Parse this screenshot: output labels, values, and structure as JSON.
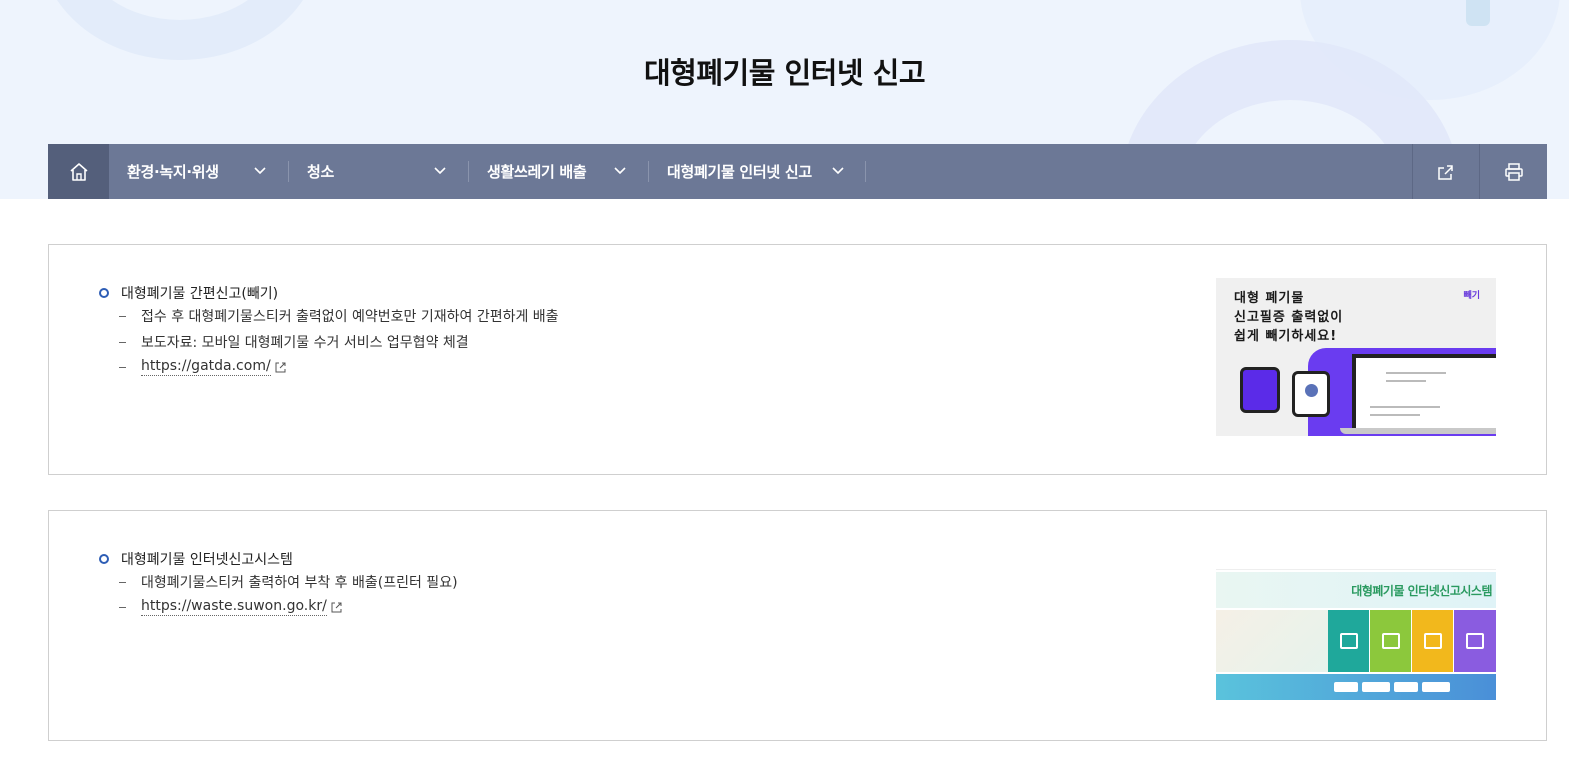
{
  "page_title": "대형폐기물 인터넷 신고",
  "nav": {
    "items": [
      {
        "label": "환경·녹지·위생"
      },
      {
        "label": "청소"
      },
      {
        "label": "생활쓰레기 배출"
      },
      {
        "label": "대형폐기물 인터넷 신고"
      }
    ]
  },
  "sections": [
    {
      "heading": "대형폐기물 간편신고(빼기)",
      "lines": [
        "접수 후 대형폐기물스티커 출력없이 예약번호만 기재하여 간편하게 배출",
        "보도자료: 모바일 대형폐기물  수거 서비스 업무협약 체결"
      ],
      "link": "https://gatda.com/",
      "image": {
        "headline_1": "대형 폐기물",
        "headline_2": "신고필증 출력없이",
        "headline_3": "쉽게 빼기하세요!",
        "logo": "빼기"
      }
    },
    {
      "heading": "대형폐기물 인터넷신고시스템",
      "lines": [
        "대형폐기물스티커 출력하여 부착 후 배출(프린터 필요)"
      ],
      "link": "https://waste.suwon.go.kr/",
      "image": {
        "title": "대형폐기물 인터넷신고시스템",
        "tiles": [
          "배출신고",
          "접수내역조회",
          "스티커출력",
          "폐기물 폐기신청"
        ]
      }
    }
  ],
  "colors": {
    "hero_bg": "#eef4fd",
    "nav_bg": "#6c7896",
    "home_bg": "#545f7b",
    "bullet": "#2d5db5"
  },
  "icons": [
    "home-icon",
    "chevron-down-icon",
    "share-icon",
    "print-icon",
    "external-link-icon"
  ]
}
